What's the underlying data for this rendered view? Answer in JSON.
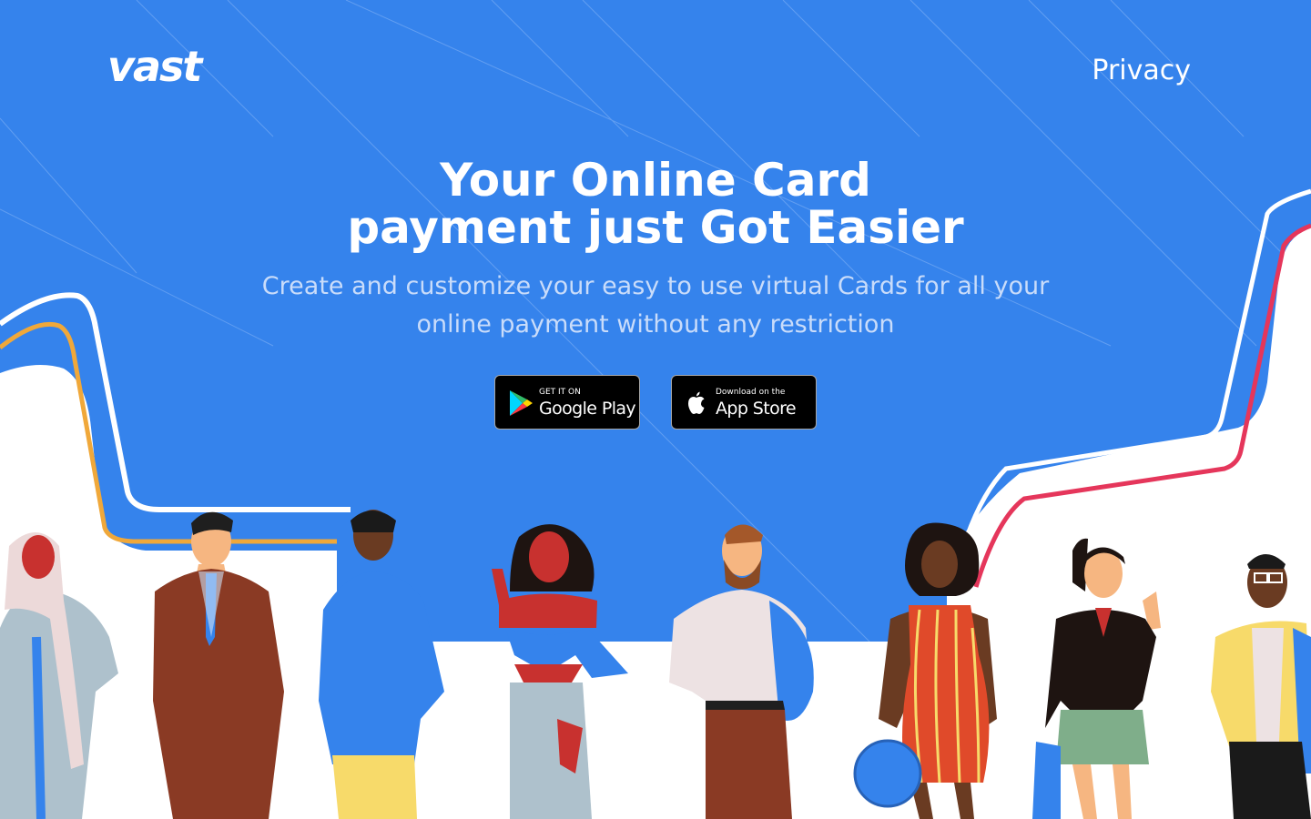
{
  "brand": {
    "logo_text": "vast"
  },
  "nav": {
    "privacy_label": "Privacy"
  },
  "hero": {
    "title_line1": "Your Online Card",
    "title_line2": "payment just Got Easier",
    "subtitle_line1": "Create and customize your easy to use virtual Cards for all your",
    "subtitle_line2": "online payment without any restriction"
  },
  "store_buttons": {
    "google": {
      "small_text": "GET IT ON",
      "big_text": "Google Play",
      "icon": "google-play-icon"
    },
    "apple": {
      "small_text": "Download on the",
      "big_text": "App Store",
      "icon": "apple-icon"
    }
  },
  "illustration": {
    "people": [
      "woman-hijab",
      "man-brown-suit",
      "man-blue-hoodie",
      "woman-red-top-waving",
      "man-beard-backpack",
      "woman-striped-dress",
      "woman-schoolgirl-waving",
      "man-glasses-yellow-shirt"
    ]
  },
  "colors": {
    "background_blue": "#3583ec",
    "white": "#ffffff",
    "accent_orange": "#f0a83a",
    "accent_red": "#e5365b",
    "button_black": "#000000",
    "subtitle": "#c9dcfa"
  }
}
